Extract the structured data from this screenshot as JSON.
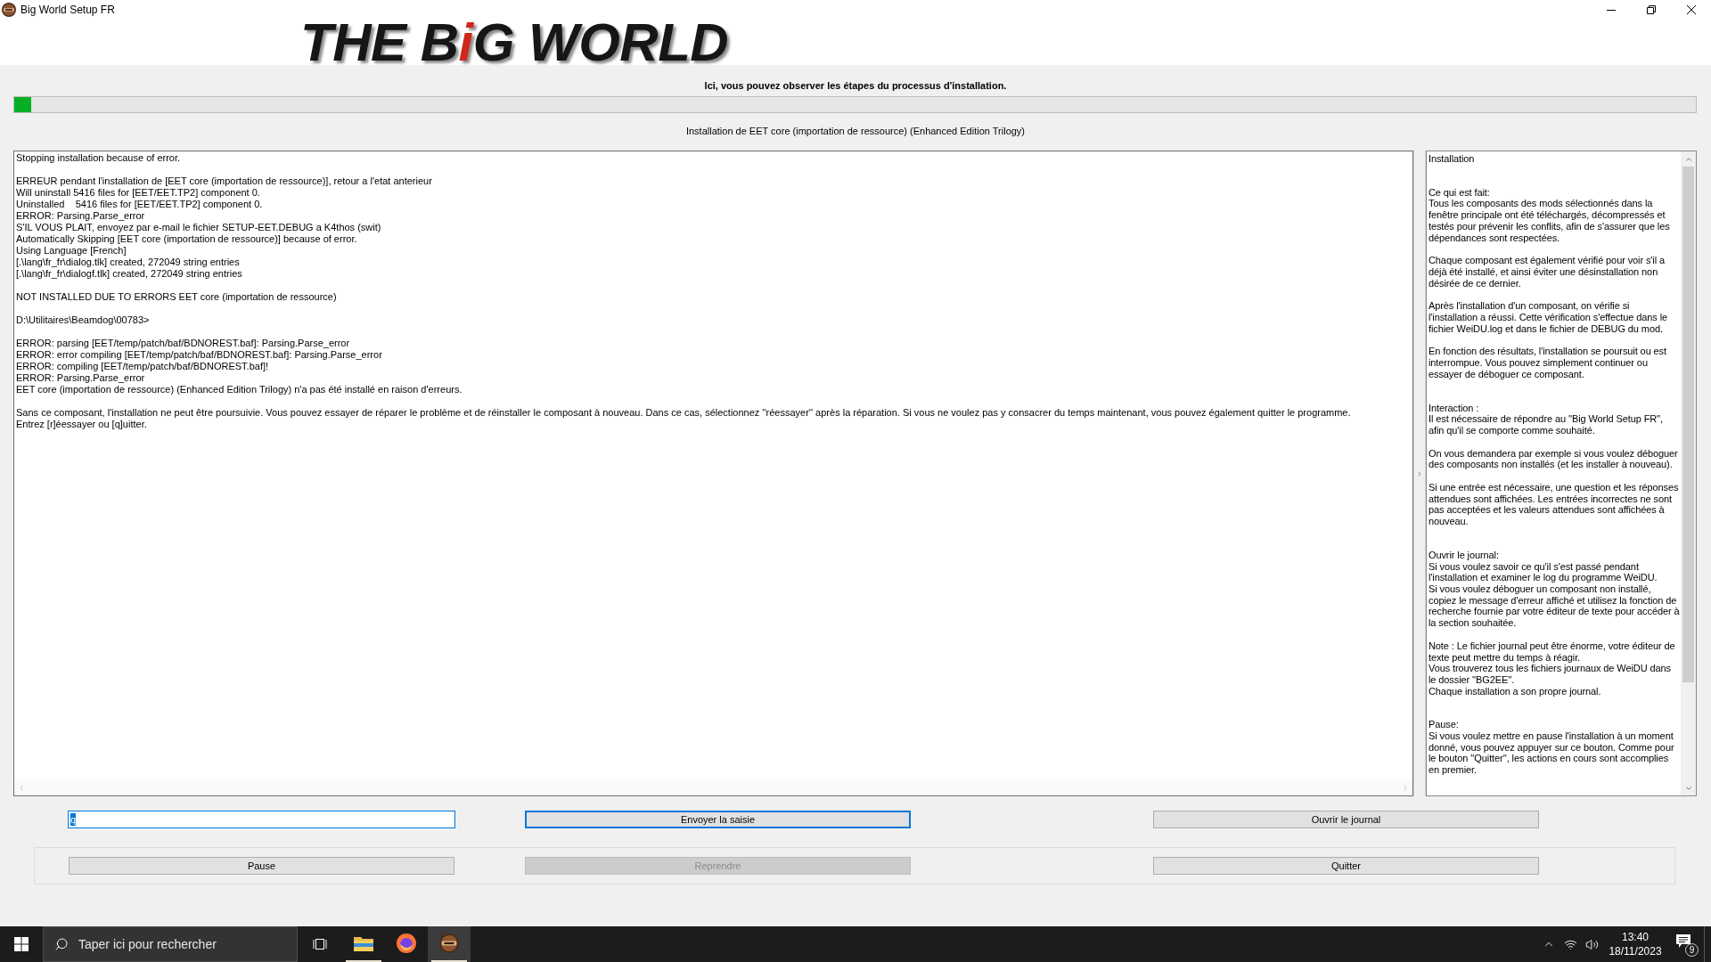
{
  "window": {
    "title": "Big World Setup FR"
  },
  "logo": {
    "parts": [
      {
        "text": "THE B",
        "color": "#161616"
      },
      {
        "text": "i",
        "color": "#d3261b"
      },
      {
        "text": "G WORLD",
        "color": "#161616"
      }
    ]
  },
  "instruction": "Ici, vous pouvez observer les étapes du processus d'installation.",
  "progress": {
    "level": 0.01
  },
  "status": "Installation de EET core (importation de ressource) (Enhanced Edition Trilogy)",
  "log": {
    "blocks": [
      [
        "Stopping installation because of error."
      ],
      [
        "ERREUR pendant l'installation de [EET core (importation de ressource)], retour a l'etat anterieur",
        "Will uninstall 5416 files for [EET/EET.TP2] component 0.",
        "Uninstalled    5416 files for [EET/EET.TP2] component 0.",
        "ERROR: Parsing.Parse_error",
        "S'IL VOUS PLAIT, envoyez par e-mail le fichier SETUP-EET.DEBUG a K4thos (swit)",
        "Automatically Skipping [EET core (importation de ressource)] because of error.",
        "Using Language [French]",
        "[.\\lang\\fr_fr\\dialog.tlk] created, 272049 string entries",
        "[.\\lang\\fr_fr\\dialogf.tlk] created, 272049 string entries"
      ],
      [
        "NOT INSTALLED DUE TO ERRORS EET core (importation de ressource)"
      ],
      [
        "D:\\Utilitaires\\Beamdog\\00783>"
      ],
      [
        "ERROR: parsing [EET/temp/patch/baf/BDNOREST.baf]: Parsing.Parse_error",
        "ERROR: error compiling [EET/temp/patch/baf/BDNOREST.baf]: Parsing.Parse_error",
        "ERROR: compiling [EET/temp/patch/baf/BDNOREST.baf]!",
        "ERROR: Parsing.Parse_error",
        "EET core (importation de ressource) (Enhanced Edition Trilogy) n'a pas été installé en raison d'erreurs."
      ],
      [
        "Sans ce composant, l'installation ne peut être poursuivie. Vous pouvez essayer de réparer le problème et de réinstaller le composant à nouveau. Dans ce cas, sélectionnez ''réessayer'' après la réparation. Si vous ne voulez pas y consacrer du temps maintenant, vous pouvez également quitter le programme.",
        "Entrez [r]éessayer ou [q]uitter."
      ]
    ]
  },
  "help": {
    "sections": [
      [
        [
          "Installation"
        ]
      ],
      [
        [
          "Ce qui est fait:",
          "Tous les composants des mods sélectionnés dans la fenêtre principale ont été téléchargés, décompressés et testés pour prévenir les conflits, afin de s'assurer que les dépendances sont respectées."
        ],
        [
          "Chaque composant est également vérifié pour voir s'il a déjà été installé, et ainsi éviter une désinstallation non désirée de ce dernier."
        ],
        [
          "Après l'installation d'un composant, on vérifie si l'installation a réussi. Cette vérification s'effectue dans le fichier WeiDU.log et dans le fichier de DEBUG du mod."
        ],
        [
          "En fonction des résultats, l'installation se poursuit ou est interrompue. Vous pouvez simplement continuer ou essayer de déboguer ce composant."
        ]
      ],
      [
        [
          "Interaction :",
          "Il est nécessaire de répondre au ''Big World Setup FR'', afin qu'il se comporte comme souhaité."
        ],
        [
          "On vous demandera par exemple si vous voulez déboguer des composants non installés (et les installer à nouveau)."
        ],
        [
          "Si une entrée est nécessaire, une question et les réponses attendues sont affichées. Les entrées incorrectes ne sont pas acceptées et les valeurs attendues sont affichées à nouveau."
        ]
      ],
      [
        [
          "Ouvrir le journal:",
          "Si vous voulez savoir ce qu'il s'est passé pendant l'installation et examiner le log du programme WeiDU.",
          "Si vous voulez déboguer un composant non installé, copiez le message d'erreur affiché et utilisez la fonction de recherche fournie par votre éditeur de texte pour accéder à la section souhaitée."
        ],
        [
          "Note : Le fichier journal peut être énorme, votre éditeur de texte peut mettre du temps à réagir.",
          "Vous trouverez tous les fichiers journaux de WeiDU dans le dossier ''BG2EE''.",
          "Chaque installation a son propre journal."
        ]
      ],
      [
        [
          "Pause:",
          "Si vous voulez mettre en pause l'installation à un moment donné, vous pouvez appuyer sur ce bouton. Comme pour le bouton ''Quitter'', les actions en cours sont accomplies en premier."
        ]
      ]
    ]
  },
  "input_row": {
    "field": {
      "value": "q",
      "focused": true,
      "value_selected": true
    },
    "buttons": [
      {
        "label": "Envoyer la saisie",
        "focused": true,
        "disabled": false
      },
      {
        "label": "Ouvrir le journal",
        "focused": false,
        "disabled": false
      }
    ]
  },
  "control_group": {
    "buttons": [
      {
        "label": "Pause",
        "focused": false,
        "disabled": false
      },
      {
        "label": "Reprendre",
        "focused": false,
        "disabled": true
      },
      {
        "label": "Quitter",
        "focused": false,
        "disabled": false
      }
    ]
  },
  "taskbar": {
    "search": {
      "placeholder": "Taper ici pour rechercher"
    },
    "apps": [
      {
        "kind": "folder",
        "running": true,
        "active": false
      },
      {
        "kind": "browser",
        "running": false,
        "active": false
      },
      {
        "kind": "setup",
        "running": true,
        "active": true
      }
    ],
    "clock": {
      "time": "13:40",
      "date": "18/11/2023"
    },
    "notifications": {
      "count": "9"
    }
  }
}
